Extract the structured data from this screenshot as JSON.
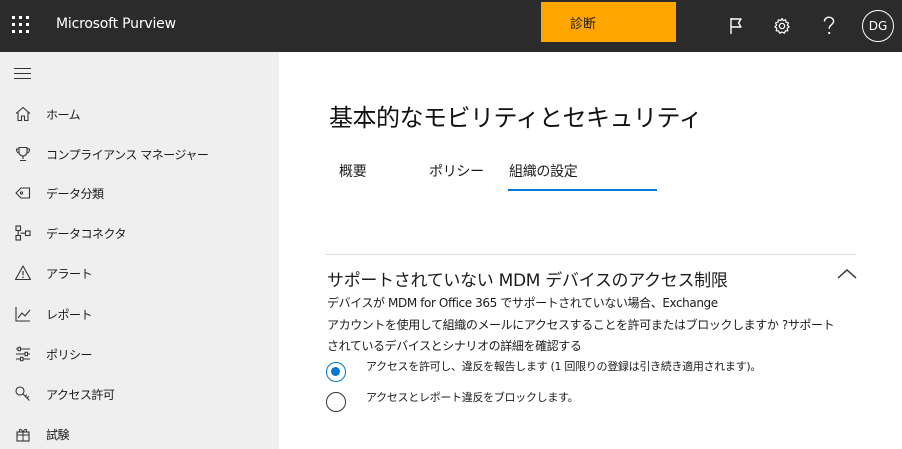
{
  "header": {
    "app_title": "Microsoft Purview",
    "diagnostics_label": "診断",
    "avatar_initials": "DG",
    "icons": [
      "waffle-icon",
      "flag-icon",
      "gear-icon",
      "help-icon"
    ]
  },
  "sidebar": {
    "items": [
      {
        "label": "ホーム",
        "icon": "home-icon"
      },
      {
        "label": "コンプライアンス マネージャー",
        "icon": "trophy-icon"
      },
      {
        "label": "データ分類",
        "icon": "tag-icon"
      },
      {
        "label": "データコネクタ",
        "icon": "connector-icon"
      },
      {
        "label": "アラート",
        "icon": "alert-icon"
      },
      {
        "label": "レポート",
        "icon": "chart-icon"
      },
      {
        "label": "ポリシー",
        "icon": "sliders-icon"
      },
      {
        "label": "アクセス許可",
        "icon": "key-icon"
      },
      {
        "label": "試験",
        "icon": "trials-icon"
      }
    ]
  },
  "main": {
    "title": "基本的なモビリティとセキュリティ",
    "tabs": [
      {
        "label": "概要"
      },
      {
        "label": "ポリシー"
      },
      {
        "label": "組織の設定",
        "active": true
      }
    ],
    "section": {
      "title": "サポートされていない MDM デバイスのアクセス制限",
      "description_lines": [
        "デバイスが MDM for Office 365 でサポートされていない場合、Exchange",
        "アカウントを使用して組織のメールにアクセスすることを許可またはブロックしますか ?サポート",
        "されているデバイスとシナリオの詳細を確認する"
      ],
      "options": [
        {
          "label": "アクセスを許可し、違反を報告します (1 回限りの登録は引き続き適用されます)。",
          "selected": true
        },
        {
          "label": "アクセスとレポート違反をブロックします。",
          "selected": false
        }
      ]
    }
  },
  "colors": {
    "topbar": "#2b2b2b",
    "diagnostics": "#ffa500",
    "sidebar": "#efefef",
    "accent": "#0078d4"
  }
}
